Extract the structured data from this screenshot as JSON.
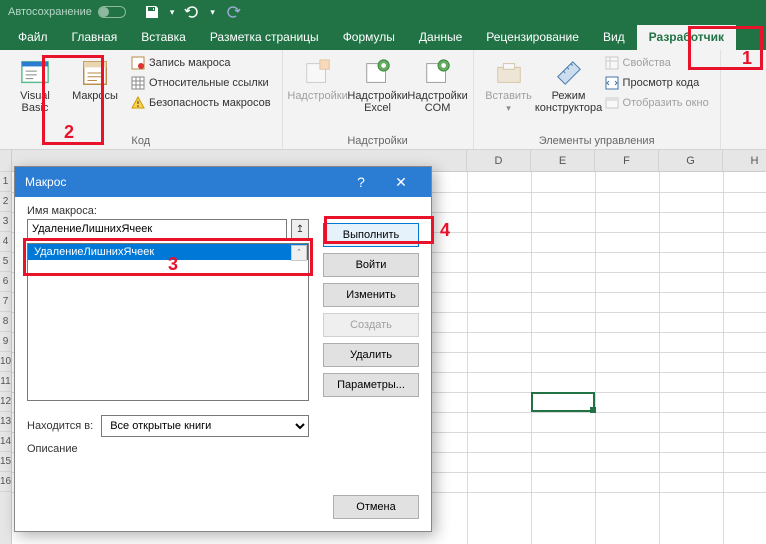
{
  "titlebar": {
    "autosave": "Автосохранение"
  },
  "tabs": {
    "file": "Файл",
    "home": "Главная",
    "insert": "Вставка",
    "layout": "Разметка страницы",
    "formulas": "Формулы",
    "data": "Данные",
    "review": "Рецензирование",
    "view": "Вид",
    "developer": "Разработчик"
  },
  "ribbon": {
    "code": {
      "vb": "Visual\nBasic",
      "macros": "Макросы",
      "record": "Запись макроса",
      "relref": "Относительные ссылки",
      "security": "Безопасность макросов",
      "title": "Код"
    },
    "addins": {
      "addins": "Надстройки",
      "excel": "Надстройки\nExcel",
      "com": "Надстройки\nCOM",
      "title": "Надстройки"
    },
    "controls": {
      "insert": "Вставить",
      "design": "Режим\nконструктора",
      "props": "Свойства",
      "viewcode": "Просмотр кода",
      "showdlg": "Отобразить окно",
      "title": "Элементы управления"
    }
  },
  "columns": [
    "D",
    "E",
    "F",
    "G",
    "H"
  ],
  "rows": [
    "1",
    "2",
    "3",
    "4",
    "5",
    "6",
    "7",
    "8",
    "9",
    "10",
    "11",
    "12",
    "13",
    "14",
    "15",
    "16"
  ],
  "dialog": {
    "title": "Макрос",
    "name_label": "Имя макроса:",
    "name_value": "УдалениеЛишнихЯчеек",
    "list_item": "УдалениеЛишнихЯчеек",
    "located_label": "Находится в:",
    "located_value": "Все открытые книги",
    "desc_label": "Описание",
    "buttons": {
      "run": "Выполнить",
      "step": "Войти",
      "edit": "Изменить",
      "create": "Создать",
      "delete": "Удалить",
      "options": "Параметры...",
      "cancel": "Отмена"
    }
  },
  "annotations": {
    "n1": "1",
    "n2": "2",
    "n3": "3",
    "n4": "4"
  }
}
